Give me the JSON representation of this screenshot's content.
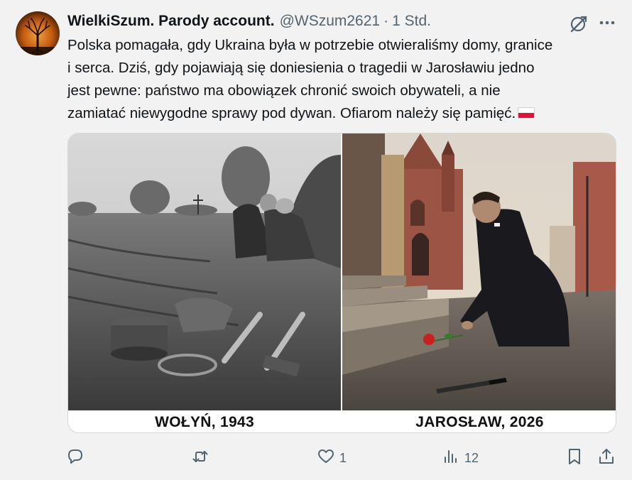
{
  "author": {
    "display_name": "WielkiSzum. Parody account.",
    "handle": "@WSzum2621",
    "separator": "·",
    "time": "1 Std."
  },
  "tweet": {
    "text_lines": [
      "Polska pomagała, gdy Ukraina była w potrzebie  otwieraliśmy domy, granice",
      "i serca. Dziś, gdy pojawiają się doniesienia o tragedii w Jarosławiu jedno",
      "jest pewne: państwo ma obowiązek chronić swoich obywateli, a nie",
      "zamiatać niewygodne sprawy pod dywan. Ofiarom należy się pamięć."
    ],
    "emoji": "flag-poland"
  },
  "media": {
    "caption_left": "WOŁYŃ, 1943",
    "caption_right": "JAROSŁAW, 2026"
  },
  "actions": {
    "reply_count": "",
    "retweet_count": "",
    "like_count": "1",
    "views_count": "12"
  },
  "icons": {
    "header": [
      "grok-icon",
      "more-icon"
    ],
    "actions": [
      "reply-icon",
      "retweet-icon",
      "like-icon",
      "views-icon",
      "bookmark-icon",
      "share-icon"
    ]
  },
  "colors": {
    "text_primary": "#0f1419",
    "text_secondary": "#536471",
    "background": "#f2f2f2",
    "flag_red": "#dc143c"
  }
}
